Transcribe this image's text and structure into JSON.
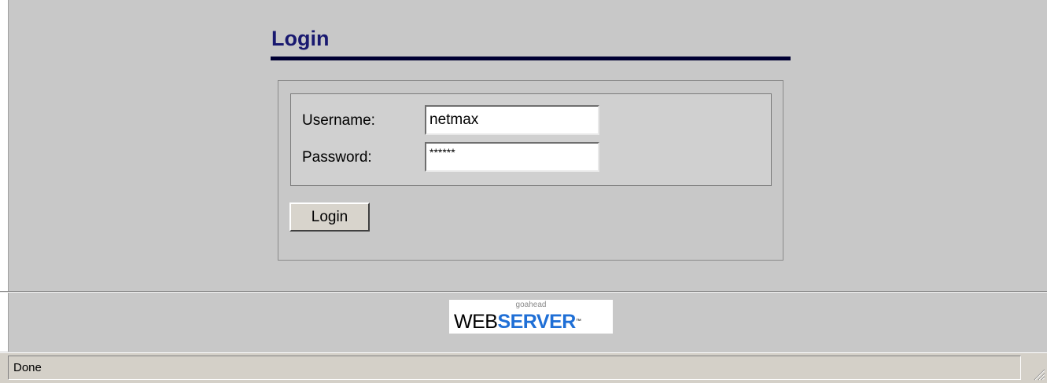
{
  "heading": {
    "title": "Login"
  },
  "form": {
    "username_label": "Username:",
    "username_value": "netmax",
    "password_label": "Password:",
    "password_value": "******",
    "submit_label": "Login"
  },
  "footer": {
    "logo_small": "goahead",
    "logo_web": "WEB",
    "logo_server": "SERVER",
    "logo_tm": "™"
  },
  "status_bar": {
    "text": "Done"
  },
  "colors": {
    "page_background": "#c8c8c8",
    "heading_text": "#191970",
    "heading_rule": "#000033",
    "logo_server": "#1f6fd6",
    "status_bar": "#d4d0c8"
  },
  "icons": {
    "resize_grip": "resize-grip-icon"
  }
}
